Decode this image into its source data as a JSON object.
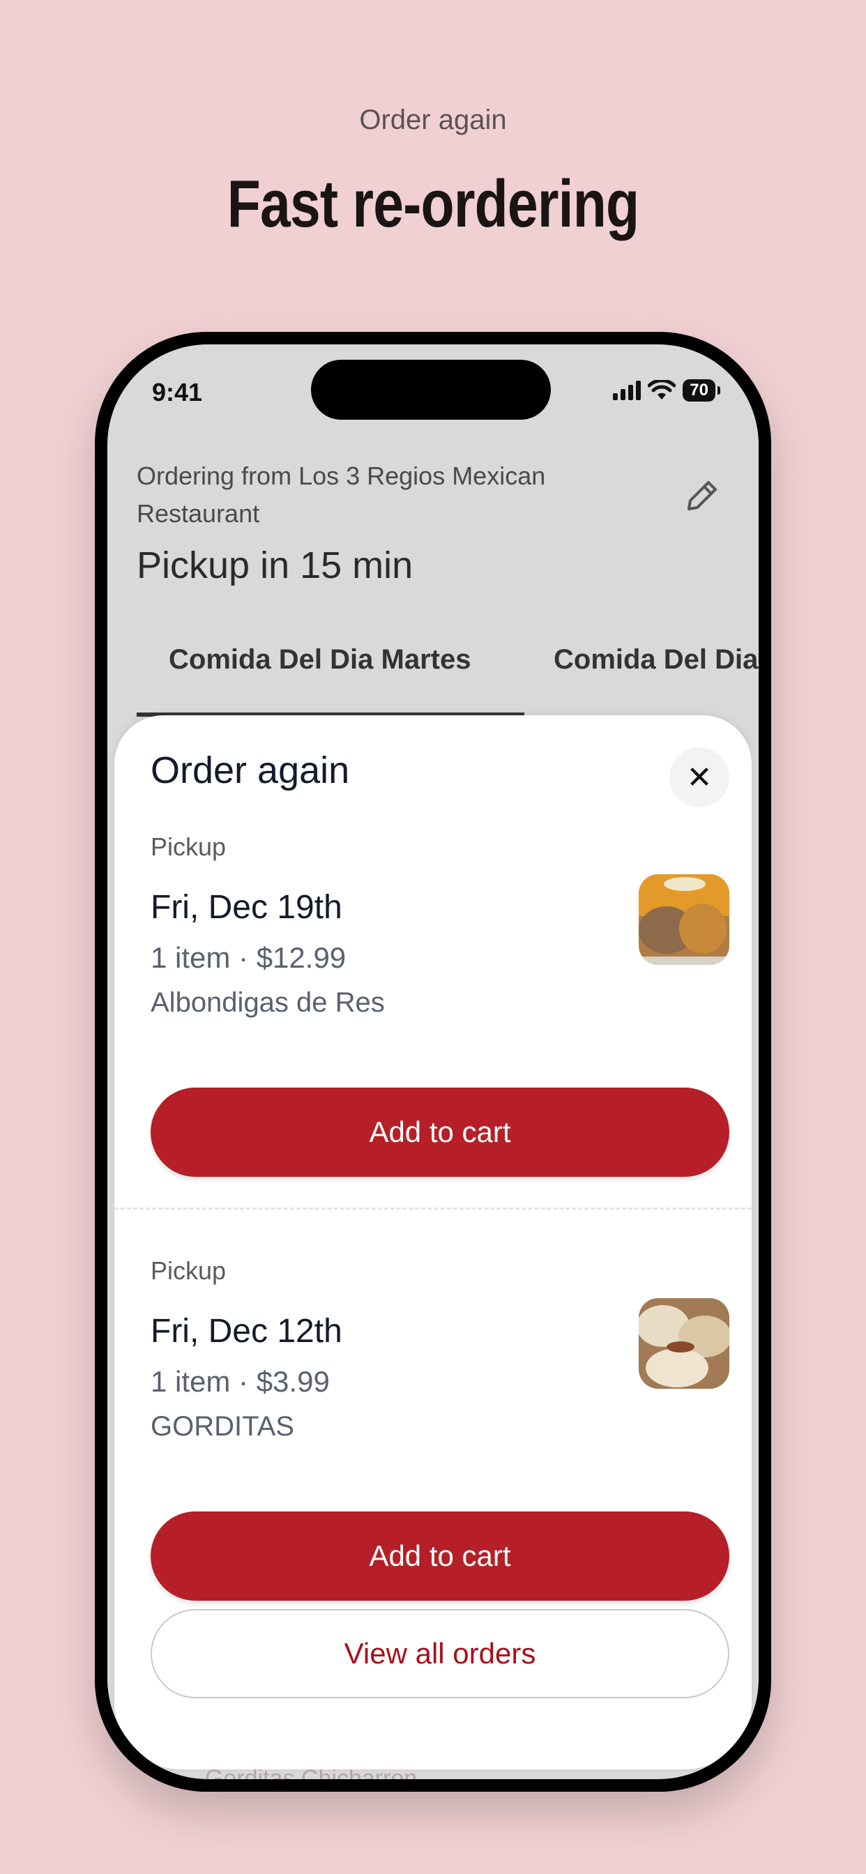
{
  "promo": {
    "subtitle": "Order again",
    "title": "Fast re-ordering"
  },
  "status_bar": {
    "time": "9:41",
    "battery": "70"
  },
  "header": {
    "ordering_from": "Ordering from Los 3 Regios Mexican Restaurant",
    "pickup": "Pickup in 15 min",
    "edit_icon": "pencil-icon"
  },
  "tabs": [
    {
      "label": "Comida Del Dia Martes",
      "active": true
    },
    {
      "label": "Comida Del Dia"
    }
  ],
  "background_item": "Gorditas Chicharron",
  "sheet": {
    "title": "Order again",
    "close_icon": "close-icon",
    "orders": [
      {
        "type": "Pickup",
        "date": "Fri, Dec 19th",
        "summary": "1 item · $12.99",
        "item": "Albondigas de Res",
        "button": "Add to cart"
      },
      {
        "type": "Pickup",
        "date": "Fri, Dec 12th",
        "summary": "1 item · $3.99",
        "item": "GORDITAS",
        "button": "Add to cart"
      }
    ],
    "view_all": "View all orders"
  },
  "colors": {
    "background": "#f0d0d3",
    "accent": "#b61f27",
    "link": "#a8101a"
  }
}
